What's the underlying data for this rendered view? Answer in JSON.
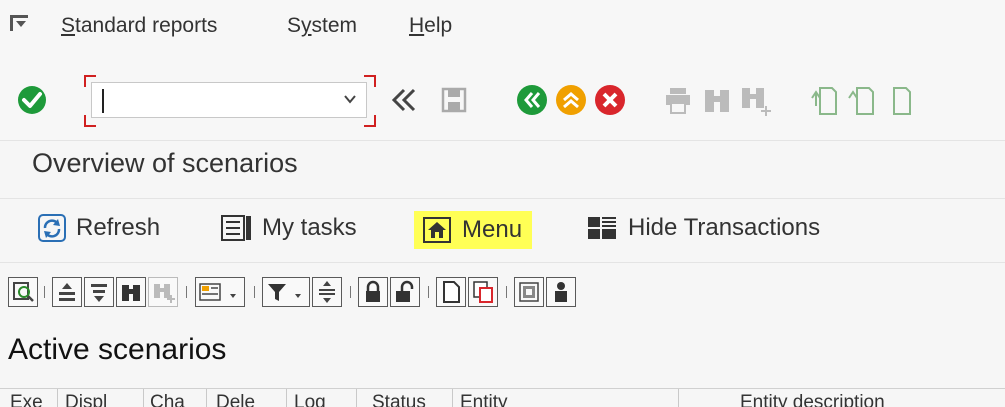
{
  "menubar": {
    "items": [
      {
        "label": "Standard reports",
        "underline": "S"
      },
      {
        "label": "System",
        "underline": "y"
      },
      {
        "label": "Help",
        "underline": "H"
      }
    ]
  },
  "toolbar": {
    "okcode_value": "",
    "icons": [
      "enter-icon",
      "back-double-icon",
      "save-icon",
      "back-icon",
      "exit-icon",
      "cancel-icon",
      "print-icon",
      "find-icon",
      "find-next-icon",
      "first-page-icon",
      "previous-page-icon",
      "next-page-icon"
    ]
  },
  "title": "Overview of scenarios",
  "app_toolbar": {
    "refresh": "Refresh",
    "my_tasks": "My tasks",
    "menu": "Menu",
    "hide_transactions": "Hide Transactions",
    "highlight_color": "#ffff55"
  },
  "section_title": "Active scenarios",
  "table": {
    "columns": [
      "Exe",
      "Displ",
      "Cha",
      "Dele",
      "Log",
      "Status",
      "Entity",
      "Entity description"
    ]
  },
  "colors": {
    "green": "#1e9a3a",
    "orange": "#f0a000",
    "red": "#d9262c"
  }
}
